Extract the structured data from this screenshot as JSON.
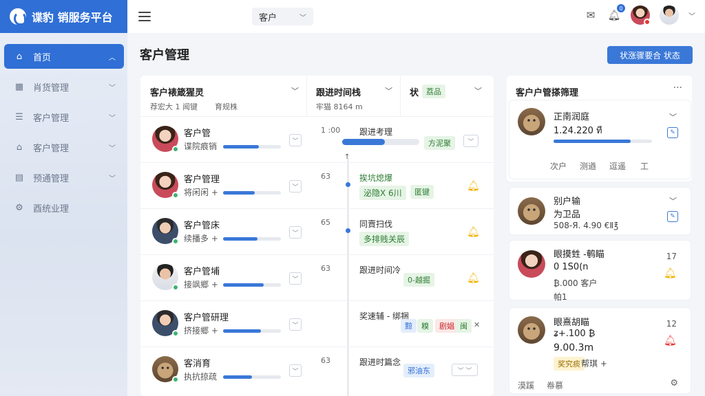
{
  "brand": {
    "title": "谍豹 销服务平台"
  },
  "sidebar": {
    "items": [
      {
        "label": "首页",
        "icon": "home-icon"
      },
      {
        "label": "肖货管理",
        "icon": "grid-icon"
      },
      {
        "label": "客户管理",
        "icon": "list-icon"
      },
      {
        "label": "客户管理",
        "icon": "building-icon"
      },
      {
        "label": "预通管理",
        "icon": "calendar-icon"
      },
      {
        "label": "酉统业理",
        "icon": "gear-icon"
      }
    ]
  },
  "header": {
    "select_value": "客户",
    "notification_count": "0"
  },
  "page": {
    "title": "客户管理",
    "primary_button": "状涨骤要合 状态"
  },
  "columns": {
    "c1": {
      "title": "客户裱箴猩灵",
      "sub_a": "荐宏大 1 闻键",
      "sub_b": "育规株"
    },
    "c2": {
      "title": "跟进时间栈",
      "sub": "牢猫 8164 m"
    },
    "c3": {
      "title": "状",
      "tag": "荔品"
    }
  },
  "rows": [
    {
      "name": "客户管",
      "sub": "谍院痕销",
      "progress": 0.62,
      "time": "1 :00",
      "event": "跟进考理",
      "status": "方泥聚"
    },
    {
      "name": "客户管理",
      "sub": "将闲闲 +",
      "progress": 0.55,
      "time": "63",
      "event": "挨坑熄爆",
      "event2a": "泌隐X 6川",
      "event2b": "匿键"
    },
    {
      "name": "客户管床",
      "sub": "续播多 +",
      "progress": 0.6,
      "time": "65",
      "event": "同賣扫伐",
      "event2": "多排贱关辰"
    },
    {
      "name": "客户管埔",
      "sub": "接飒郷 +",
      "progress": 0.7,
      "time": "63",
      "event": "跟进时间冷",
      "status": "0-越掘"
    },
    {
      "name": "客户管研理",
      "sub": "挤接郷 +",
      "progress": 0.65,
      "event": "奖速辅 - 绑捆",
      "tags": [
        "黥",
        "糗",
        "剧娼",
        "闽"
      ]
    },
    {
      "name": "客消育",
      "sub": "执抗掠疏",
      "progress": 0.5,
      "time": "63",
      "event": "跟进时篇念",
      "status": "邪油东"
    }
  ],
  "right_panel": {
    "title": "客户户管搽筛理",
    "cards": [
      {
        "l1": "正南润庭",
        "l2": "1.24.220 ที",
        "progress": 0.78,
        "footer": [
          "次户",
          "测遒",
          "逗遥",
          "工"
        ]
      },
      {
        "l1": "别户输",
        "l2": "为卫品",
        "l3": "508-Я. 4.90 €Ⅱ℥"
      },
      {
        "l1": "眼摸甡 -鹌瞄",
        "l2": "0 1S0(n",
        "l3": "₿.000 客户",
        "l4": "帕1",
        "num": "17"
      },
      {
        "l1": "眼熹胡瞄",
        "l2": "ʑ+.100 ₿",
        "l3": "9.00.3m",
        "tag": "奖究痰",
        "l4": "帮琪 +",
        "num": "12",
        "footer": [
          "漠蹊",
          "帣慕"
        ]
      }
    ]
  },
  "colors": {
    "accent": "#2f6fd6",
    "success": "#3cb371",
    "warning": "#f2b200",
    "danger": "#e53935"
  }
}
